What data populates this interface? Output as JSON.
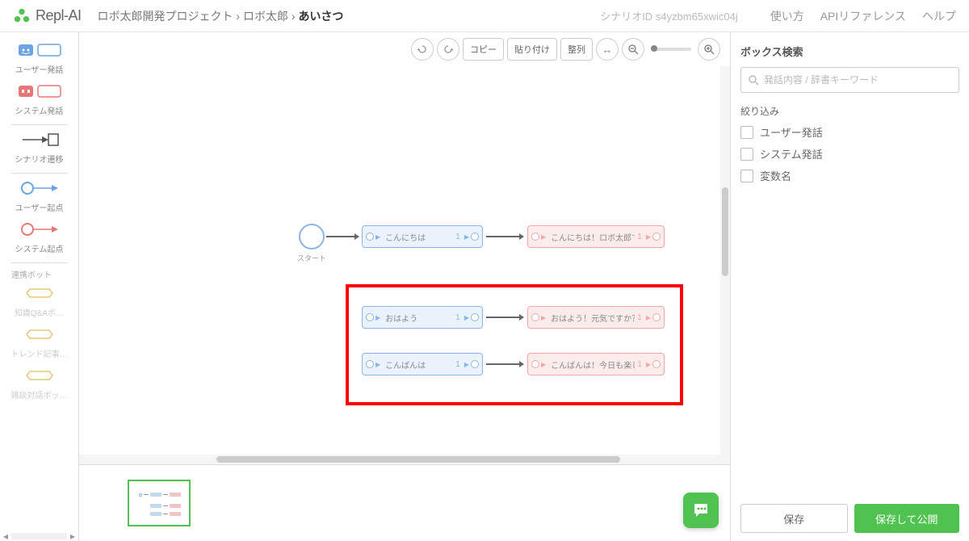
{
  "header": {
    "logo_text": "Repl-AI",
    "breadcrumb": {
      "part1": "ロボ太郎開発プロジェクト",
      "part2": "ロボ太郎",
      "current": "あいさつ"
    },
    "scenario_id_label": "シナリオID",
    "scenario_id": "s4yzbm65xwic04j",
    "links": {
      "usage": "使い方",
      "api": "APIリファレンス",
      "help": "ヘルプ"
    }
  },
  "sidebar": {
    "user_utterance": "ユーザー発話",
    "system_utterance": "システム発話",
    "scenario_transition": "シナリオ遷移",
    "user_origin": "ユーザー起点",
    "system_origin": "システム起点",
    "linked_bot": "連携ボット",
    "knowledge_qa": "知識Q&Aボ…",
    "trend_article": "トレンド記事…",
    "chat_bot": "雑談対話ボッ…"
  },
  "toolbar": {
    "copy": "コピー",
    "paste": "貼り付け",
    "align": "整列"
  },
  "canvas": {
    "start_label": "スタート",
    "nodes": {
      "n1": {
        "text": "こんにちは",
        "count": "1"
      },
      "n2": {
        "text": "こんにちは！ロボ太郎です",
        "count": "1"
      },
      "n3": {
        "text": "おはよう",
        "count": "1"
      },
      "n4": {
        "text": "おはよう！元気ですか？",
        "count": "1"
      },
      "n5": {
        "text": "こんばんは",
        "count": "1"
      },
      "n6": {
        "text": "こんばんは！今日も楽しか",
        "count": "1"
      }
    }
  },
  "right_panel": {
    "title": "ボックス検索",
    "search_placeholder": "発話内容 / 辞書キーワード",
    "filter_label": "絞り込み",
    "filters": {
      "user": "ユーザー発話",
      "system": "システム発話",
      "variable": "変数名"
    },
    "save_btn": "保存",
    "publish_btn": "保存して公開"
  }
}
